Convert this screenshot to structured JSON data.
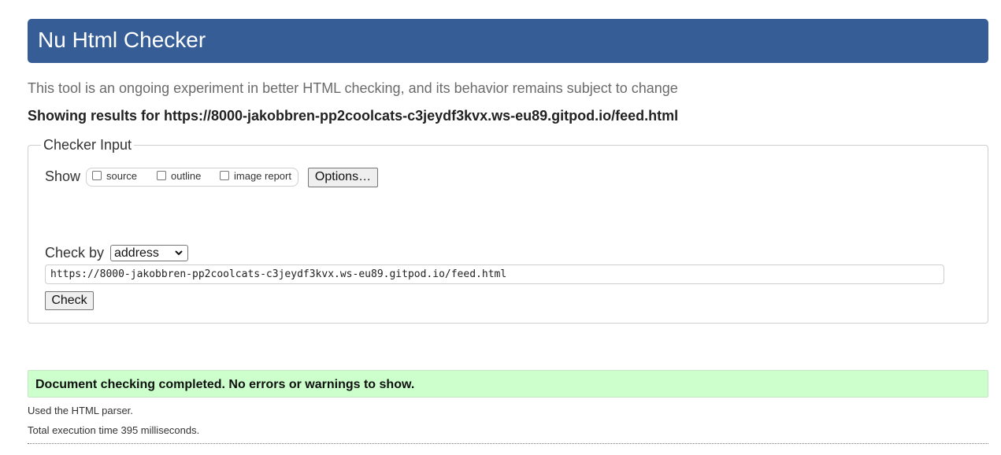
{
  "header": {
    "title": "Nu Html Checker"
  },
  "tagline": "This tool is an ongoing experiment in better HTML checking, and its behavior remains subject to change",
  "results_heading": "Showing results for https://8000-jakobbren-pp2coolcats-c3jeydf3kvx.ws-eu89.gitpod.io/feed.html",
  "checker_input": {
    "legend": "Checker Input",
    "show_label": "Show",
    "show_options": [
      {
        "label": "source",
        "checked": false
      },
      {
        "label": "outline",
        "checked": false
      },
      {
        "label": "image report",
        "checked": false
      }
    ],
    "options_button": "Options…",
    "check_by_label": "Check by",
    "check_by_selected": "address",
    "url_value": "https://8000-jakobbren-pp2coolcats-c3jeydf3kvx.ws-eu89.gitpod.io/feed.html",
    "check_button": "Check"
  },
  "result": {
    "message": "Document checking completed. No errors or warnings to show.",
    "parser_info": "Used the HTML parser.",
    "time_info": "Total execution time 395 milliseconds."
  },
  "colors": {
    "header_bg": "#365d95",
    "success_bg": "#ccffcc"
  },
  "icons": {
    "select_arrow": "chevron-down-icon",
    "checkbox": "checkbox-unchecked-icon"
  }
}
